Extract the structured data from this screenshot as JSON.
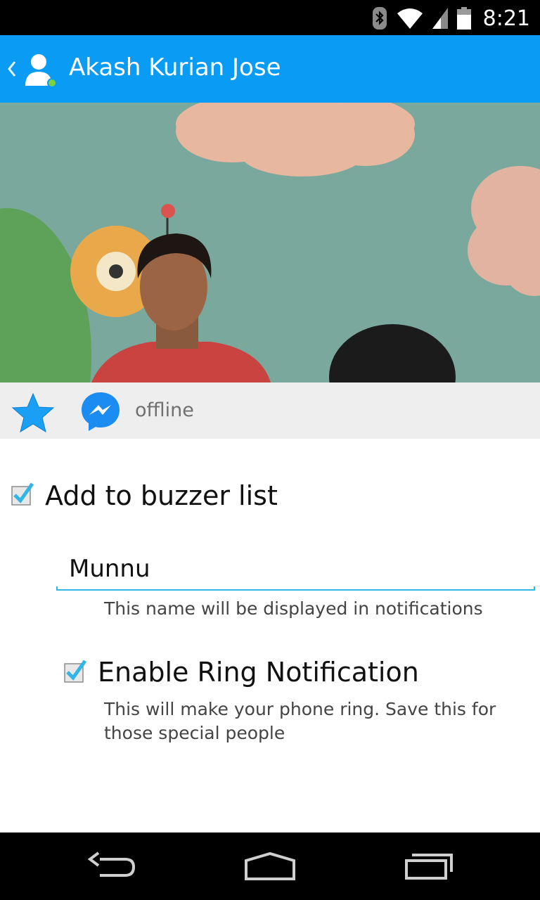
{
  "status_bar": {
    "time": "8:21",
    "icons": [
      "bluetooth-icon",
      "wifi-icon",
      "signal-icon",
      "battery-icon"
    ]
  },
  "app_bar": {
    "title": "Akash Kurian Jose",
    "icons": [
      "back-chevron-icon",
      "contact-avatar-icon"
    ],
    "color": "#0a9cf5"
  },
  "contact": {
    "presence_status": "offline",
    "icons": [
      "star-icon",
      "messenger-icon"
    ]
  },
  "settings": {
    "buzzer": {
      "label": "Add to buzzer list",
      "checked": true
    },
    "display_name": {
      "value": "Munnu",
      "hint": "This name will be displayed in notifications"
    },
    "ring": {
      "label": "Enable Ring Notification",
      "checked": true,
      "description": "This will make your phone ring. Save this for those special people"
    }
  },
  "nav_bar": {
    "icons": [
      "back-icon",
      "home-icon",
      "recents-icon"
    ]
  },
  "colors": {
    "accent": "#0a9cf5",
    "checkbox_check": "#33b5e5",
    "input_underline": "#33b5e5"
  }
}
